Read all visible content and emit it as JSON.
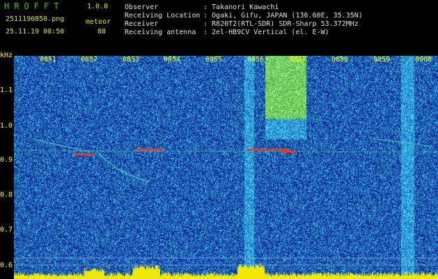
{
  "app": {
    "title": "HROFFT",
    "version": "1.0.0"
  },
  "file": {
    "name": "2511190850.png",
    "timestamp": "25.11.19 08:50"
  },
  "detection": {
    "mode_label": "meteor",
    "count": "88"
  },
  "station": [
    {
      "key": "Observer",
      "value": ": Takanori Kawachi"
    },
    {
      "key": "Receiving Location",
      "value": ": Ogaki, Gifu, JAPAN (136.60E, 35.35N)"
    },
    {
      "key": "Receiver",
      "value": ": R820T2(RTL-SDR) SDR-Sharp 53.372MHz"
    },
    {
      "key": "Receiving antenna",
      "value": ": 2el-HB9CV Vertical (el. E-W)"
    }
  ],
  "spectrogram": {
    "freq_unit": "kHz",
    "freq_ticks": [
      "1.1",
      "1.0",
      "0.9",
      "0.8",
      "0.7",
      "0.6"
    ],
    "time_ticks": [
      "0851",
      "0852",
      "0853",
      "0854",
      "0855",
      "0856",
      "0857",
      "0858",
      "0859",
      "0900"
    ],
    "colors": {
      "background": "#0a1f8c",
      "noise": "#2e6ad0",
      "echo": "#e83a2a",
      "trace": "#4ad0b0",
      "bottom_bar": "#f0e800",
      "label": "#ffff00"
    }
  }
}
